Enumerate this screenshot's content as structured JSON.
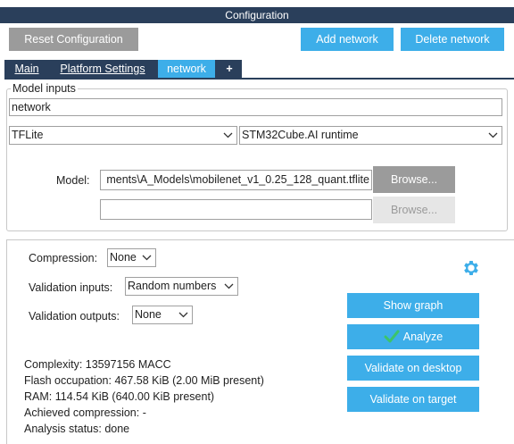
{
  "window": {
    "title": "Configuration"
  },
  "toolbar": {
    "reset_label": "Reset Configuration",
    "add_network_label": "Add network",
    "delete_network_label": "Delete network"
  },
  "tabs": [
    {
      "label": "Main"
    },
    {
      "label": "Platform Settings"
    },
    {
      "label": "network",
      "active": true
    },
    {
      "label": "+"
    }
  ],
  "model_inputs": {
    "legend": "Model inputs",
    "network_name": "network",
    "framework": "TFLite",
    "runtime": "STM32Cube.AI runtime",
    "model_label": "Model:",
    "model_path": "ments\\A_Models\\mobilenet_v1_0.25_128_quant.tflite",
    "browse_label": "Browse...",
    "second_path": "",
    "browse2_label": "Browse..."
  },
  "settings": {
    "compression_label": "Compression:",
    "compression_value": "None",
    "validation_inputs_label": "Validation inputs:",
    "validation_inputs_value": "Random numbers",
    "validation_outputs_label": "Validation outputs:",
    "validation_outputs_value": "None"
  },
  "actions": {
    "show_graph": "Show graph",
    "analyze": "Analyze",
    "validate_desktop": "Validate on desktop",
    "validate_target": "Validate on target"
  },
  "analysis": {
    "complexity": "Complexity:  13597156 MACC",
    "flash": "Flash occupation: 467.58 KiB (2.00 MiB present)",
    "ram": "RAM: 114.54 KiB (640.00 KiB present)",
    "compression": "Achieved compression: -",
    "status": "Analysis status: done"
  },
  "colors": {
    "title_bar": "#2a3f5b",
    "accent_blue": "#3daee9",
    "button_gray": "#9b9b9b",
    "check_green": "#3cc46a"
  },
  "icons": {
    "settings": "gear-icon",
    "analyze": "check-icon",
    "dropdown": "chevron-down-icon"
  }
}
